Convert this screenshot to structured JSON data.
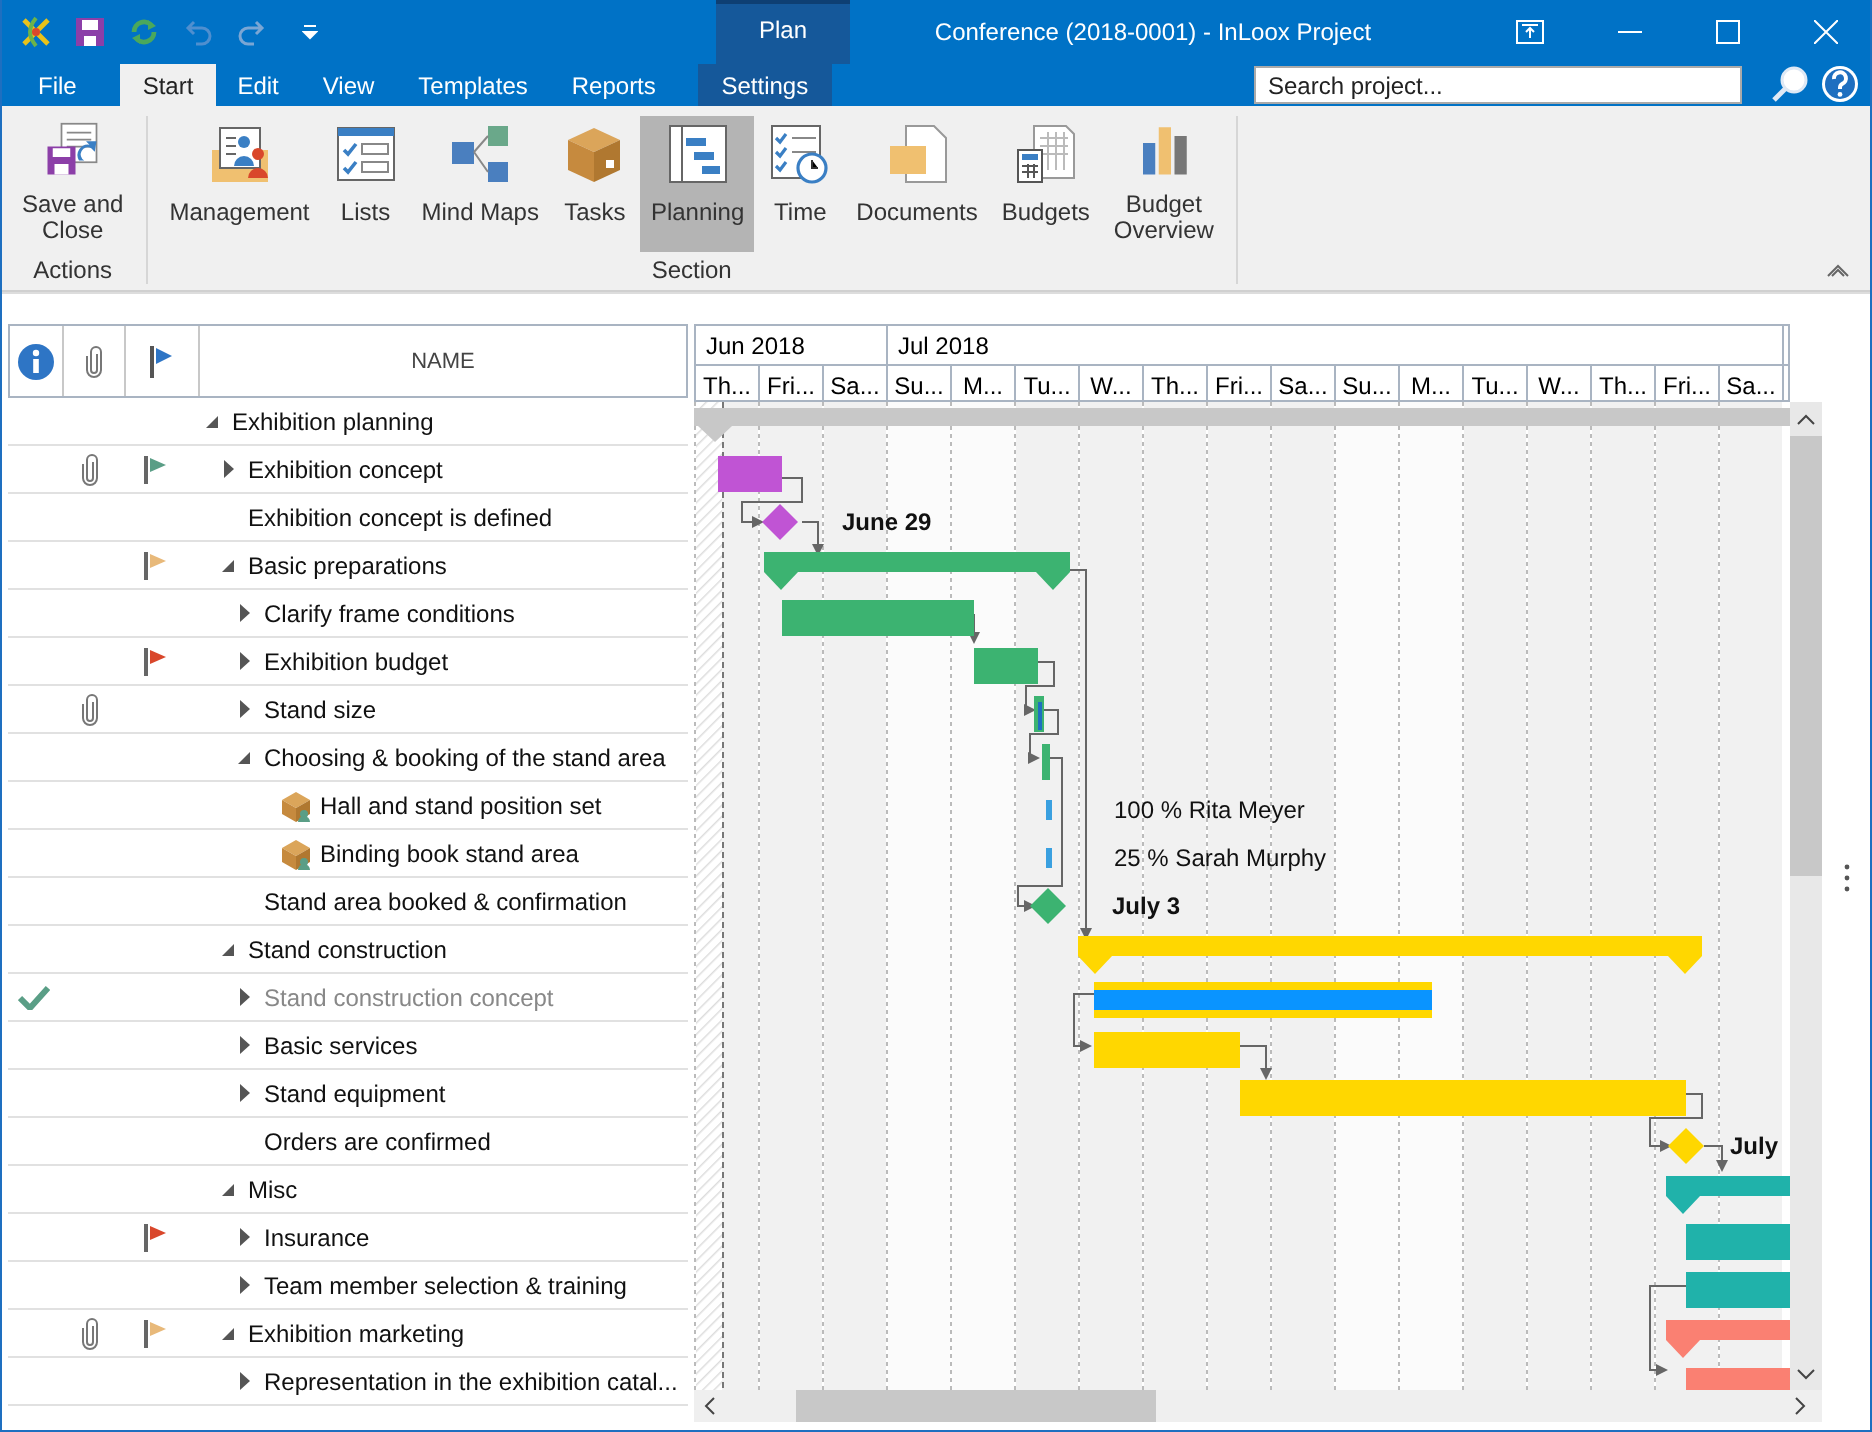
{
  "window": {
    "title": "Conference (2018-0001) - InLoox Project"
  },
  "context_tab": {
    "label": "Plan"
  },
  "tabs": [
    {
      "label": "File",
      "selected": false,
      "kind": "file"
    },
    {
      "label": "Start",
      "selected": true,
      "kind": "normal"
    },
    {
      "label": "Edit",
      "selected": false,
      "kind": "normal"
    },
    {
      "label": "View",
      "selected": false,
      "kind": "normal"
    },
    {
      "label": "Templates",
      "selected": false,
      "kind": "normal"
    },
    {
      "label": "Reports",
      "selected": false,
      "kind": "normal"
    },
    {
      "label": "Settings",
      "selected": false,
      "kind": "context"
    }
  ],
  "search": {
    "placeholder": "Search project..."
  },
  "ribbon": {
    "groups": [
      {
        "label": "Actions",
        "buttons": [
          {
            "label": "Save and\nClose",
            "kind": "save",
            "selected": false
          }
        ]
      },
      {
        "label": "Section",
        "buttons": [
          {
            "label": "Management",
            "kind": "management",
            "selected": false
          },
          {
            "label": "Lists",
            "kind": "lists",
            "selected": false
          },
          {
            "label": "Mind Maps",
            "kind": "mindmap",
            "selected": false
          },
          {
            "label": "Tasks",
            "kind": "tasks",
            "selected": false
          },
          {
            "label": "Planning",
            "kind": "planning",
            "selected": true
          },
          {
            "label": "Time",
            "kind": "time",
            "selected": false
          },
          {
            "label": "Documents",
            "kind": "documents",
            "selected": false
          },
          {
            "label": "Budgets",
            "kind": "budgets",
            "selected": false
          },
          {
            "label": "Budget\nOverview",
            "kind": "overview",
            "selected": false
          }
        ]
      }
    ]
  },
  "table": {
    "name_header": "NAME",
    "rows": [
      {
        "name": "Exhibition planning",
        "kind": "task",
        "expanded": true,
        "attachment": false,
        "done": false,
        "children": [
          {
            "name": "Exhibition concept",
            "kind": "task",
            "expanded": false,
            "attachment": true,
            "done": false,
            "color": "#5a9e86"
          },
          {
            "name": "Exhibition concept is defined",
            "kind": "milestone",
            "attachment": false,
            "done": false
          },
          {
            "name": "Basic preparations",
            "kind": "task",
            "expanded": true,
            "attachment": false,
            "done": false,
            "color": "#e8b97a",
            "children": [
              {
                "name": "Clarify frame conditions",
                "kind": "task",
                "expanded": false,
                "attachment": false,
                "done": false
              },
              {
                "name": "Exhibition budget",
                "kind": "task",
                "expanded": false,
                "attachment": false,
                "done": false,
                "color": "#d9472b"
              },
              {
                "name": "Stand size",
                "kind": "task",
                "expanded": false,
                "attachment": true,
                "done": false
              },
              {
                "name": "Choosing & booking of the stand area",
                "kind": "task",
                "expanded": true,
                "attachment": false,
                "done": false,
                "children": [
                  {
                    "name": "Hall and stand position set",
                    "kind": "package",
                    "attachment": false,
                    "done": false
                  },
                  {
                    "name": "Binding book stand area",
                    "kind": "package",
                    "attachment": false,
                    "done": false
                  }
                ]
              },
              {
                "name": "Stand area booked & confirmation",
                "kind": "milestone",
                "attachment": false,
                "done": false
              }
            ]
          },
          {
            "name": "Stand construction",
            "kind": "task",
            "expanded": true,
            "attachment": false,
            "done": false,
            "children": [
              {
                "name": "Stand construction concept",
                "kind": "task",
                "expanded": false,
                "attachment": false,
                "done": true
              },
              {
                "name": "Basic services",
                "kind": "task",
                "expanded": false,
                "attachment": false,
                "done": false
              },
              {
                "name": "Stand equipment",
                "kind": "task",
                "expanded": false,
                "attachment": false,
                "done": false
              },
              {
                "name": "Orders are confirmed",
                "kind": "milestone",
                "attachment": false,
                "done": false
              }
            ]
          },
          {
            "name": "Misc",
            "kind": "task",
            "expanded": true,
            "attachment": false,
            "done": false,
            "children": [
              {
                "name": "Insurance",
                "kind": "task",
                "expanded": false,
                "attachment": false,
                "done": false,
                "color": "#d9472b"
              },
              {
                "name": "Team member selection & training",
                "kind": "task",
                "expanded": false,
                "attachment": false,
                "done": false
              }
            ]
          },
          {
            "name": "Exhibition marketing",
            "kind": "task",
            "expanded": true,
            "attachment": true,
            "done": false,
            "color": "#e8b97a",
            "children": [
              {
                "name": "Representation in the exhibition catal...",
                "kind": "task",
                "expanded": false,
                "attachment": false,
                "done": false
              }
            ]
          }
        ]
      }
    ]
  },
  "gantt": {
    "months": [
      {
        "label": "Jun 2018",
        "days": [
          "Th...",
          "Fri...",
          "Sa..."
        ]
      },
      {
        "label": "Jul 2018",
        "days": [
          "Su...",
          "M...",
          "Tu...",
          "W...",
          "Th...",
          "Fri...",
          "Sa...",
          "Su...",
          "M...",
          "Tu...",
          "W...",
          "Th...",
          "Fri...",
          "Sa..."
        ]
      }
    ],
    "labels": [
      {
        "text": "June 29",
        "kind": "milestone"
      },
      {
        "text": "100 % Rita Meyer",
        "kind": "resource"
      },
      {
        "text": "25 % Sarah Murphy",
        "kind": "resource"
      },
      {
        "text": "July 3",
        "kind": "milestone"
      },
      {
        "text": "July",
        "kind": "milestone"
      }
    ]
  }
}
